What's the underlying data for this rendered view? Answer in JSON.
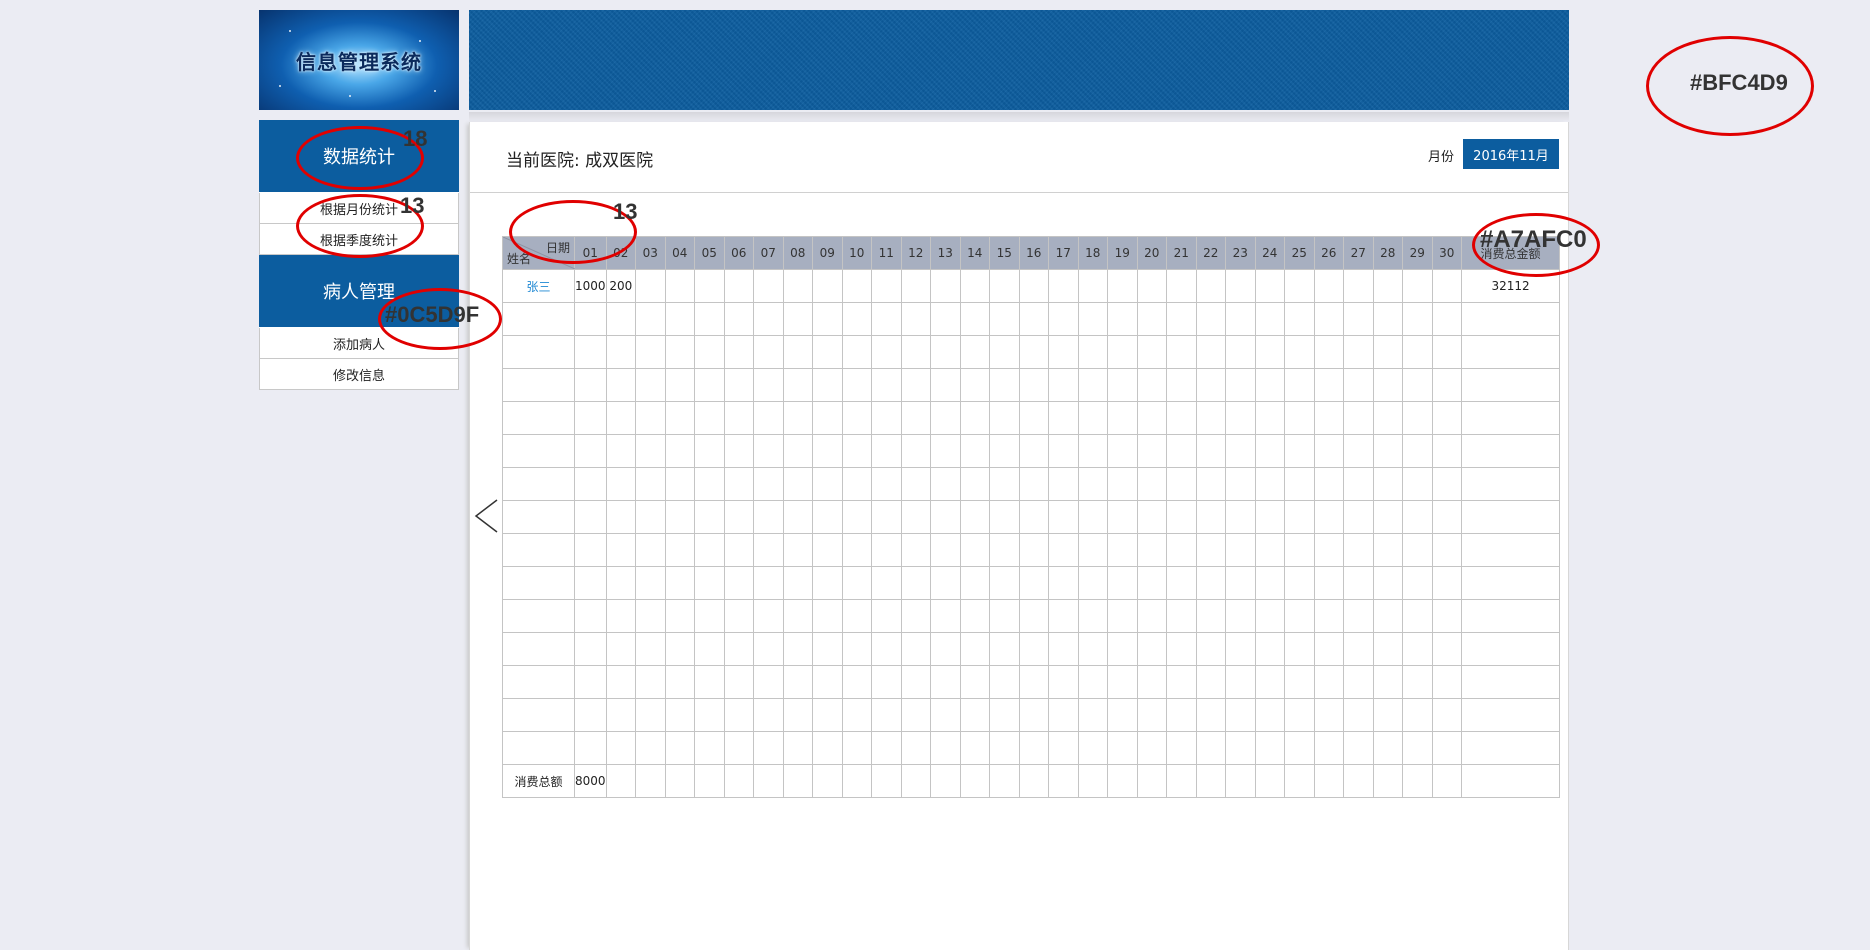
{
  "app": {
    "title": "信息管理系统"
  },
  "sidebar": {
    "groups": [
      {
        "label": "数据统计",
        "items": [
          "根据月份统计",
          "根据季度统计"
        ]
      },
      {
        "label": "病人管理",
        "items": [
          "添加病人",
          "修改信息"
        ]
      }
    ]
  },
  "header": {
    "hospital": "当前医院: 成双医院",
    "month_label": "月份",
    "month_value": "2016年11月"
  },
  "table": {
    "corner_top": "日期",
    "corner_bottom": "姓名",
    "days": [
      "01",
      "02",
      "03",
      "04",
      "05",
      "06",
      "07",
      "08",
      "09",
      "10",
      "11",
      "12",
      "13",
      "14",
      "15",
      "16",
      "17",
      "18",
      "19",
      "20",
      "21",
      "22",
      "23",
      "24",
      "25",
      "26",
      "27",
      "28",
      "29",
      "30"
    ],
    "total_header": "消费总金额",
    "rows": [
      {
        "name": "张三",
        "values": {
          "01": "1000",
          "02": "200"
        },
        "total": "32112"
      }
    ],
    "empty_rows": 14,
    "footer": {
      "label": "消费总额",
      "values": {
        "01": "8000"
      }
    }
  },
  "annotations": [
    {
      "text": "18"
    },
    {
      "text": "13"
    },
    {
      "text": "13"
    },
    {
      "text": "#0C5D9F"
    },
    {
      "text": "#A7AFC0"
    },
    {
      "text": "#BFC4D9"
    }
  ],
  "colors": {
    "brand": "#0C5D9F",
    "table_header": "#A7AFC0",
    "page_bg": "#BFC4D9",
    "annotation": "#E00000"
  }
}
